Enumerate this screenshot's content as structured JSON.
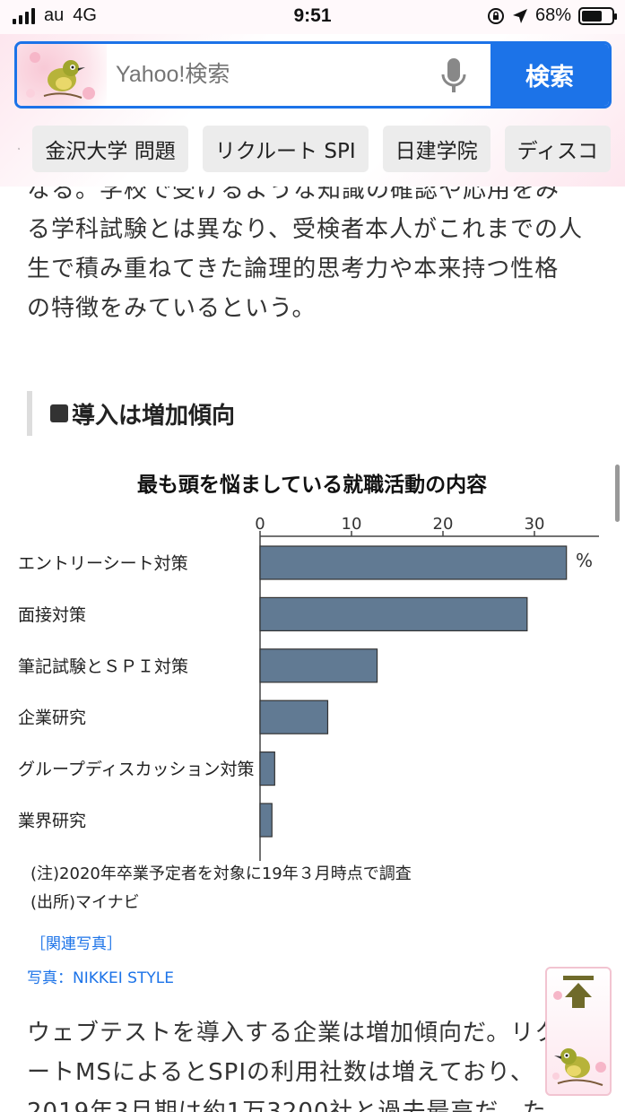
{
  "status_bar": {
    "carrier": "au",
    "network": "4G",
    "time": "9:51",
    "battery": "68%",
    "battery_level": 0.68,
    "icons": [
      "signal-icon",
      "rotation-lock-icon",
      "location-arrow-icon",
      "battery-icon"
    ]
  },
  "search": {
    "placeholder": "Yahoo!検索",
    "button_label": "検索",
    "accent": "#1c73e8"
  },
  "suggestions": [
    "金沢大学 問題",
    "リクルート SPI",
    "日建学院",
    "ディスコ"
  ],
  "article": {
    "paragraph_1": "なる。学校で受けるような知識の確認や応用をみる学科試験とは異なり、受検者本人がこれまでの人生で積み重ねてきた論理的思考力や本来持つ性格の特徴をみているという。",
    "section_title": "導入は増加傾向",
    "related_photo": "［関連写真］",
    "photo_caption": "写真：NIKKEI STYLE",
    "paragraph_2": "ウェブテストを導入する企業は増加傾向だ。リクルートMSによるとSPIの利用社数は増えており、2019年3月期は約1万3200社と過去最高だ。た"
  },
  "chart_data": {
    "type": "bar",
    "orientation": "horizontal",
    "title": "最も頭を悩ましている就職活動の内容",
    "unit": "%",
    "categories": [
      "エントリーシート対策",
      "面接対策",
      "筆記試験とＳＰＩ対策",
      "企業研究",
      "グループディスカッション対策",
      "業界研究"
    ],
    "values": [
      33.5,
      29.2,
      12.8,
      7.4,
      1.6,
      1.3
    ],
    "xlim": [
      0,
      37
    ],
    "ticks": [
      0,
      10,
      20,
      30
    ],
    "bar_color": "#617a93",
    "notes": [
      "(注)2020年卒業予定者を対象に19年３月時点で調査",
      "(出所)マイナビ"
    ]
  }
}
